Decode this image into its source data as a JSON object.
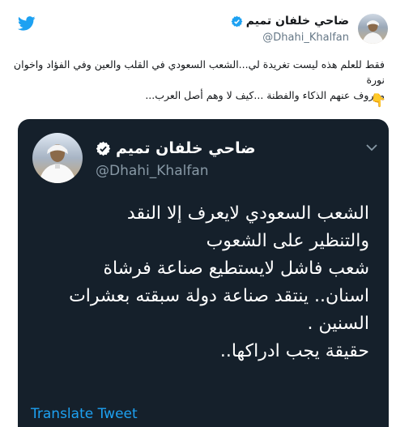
{
  "tweet": {
    "author": {
      "name": "ضاحي خلفان تميم",
      "handle": "@Dhahi_Khalfan",
      "verified": true
    },
    "text_line1": "فقط للعلم هذه ليست تغريدة لي...الشعب السعودي في القلب والعين وفي الفؤاد واخوان نورة",
    "text_line2": "معروف عنهم الذكاء والفطنة ...كيف لا وهم أصل العرب...",
    "emoji": "👇"
  },
  "embedded_tweet": {
    "author": {
      "name": "ضاحي خلفان تميم",
      "handle": "@Dhahi_Khalfan",
      "verified": true
    },
    "text": "الشعب السعودي لايعرف إلا النقد\nوالتنظير على الشعوب\nشعب فاشل لايستطيع صناعة فرشاة\nاسنان.. ينتقد صناعة دولة سبقته بعشرات\nالسنين .\nحقيقة يجب ادراكها..",
    "translate_label": "Translate Tweet"
  },
  "colors": {
    "twitter_blue": "#1da1f2",
    "dark_bg": "#15202b",
    "muted": "#657786"
  },
  "icons": [
    "twitter-bird-icon",
    "verified-badge-icon",
    "chevron-down-icon"
  ]
}
